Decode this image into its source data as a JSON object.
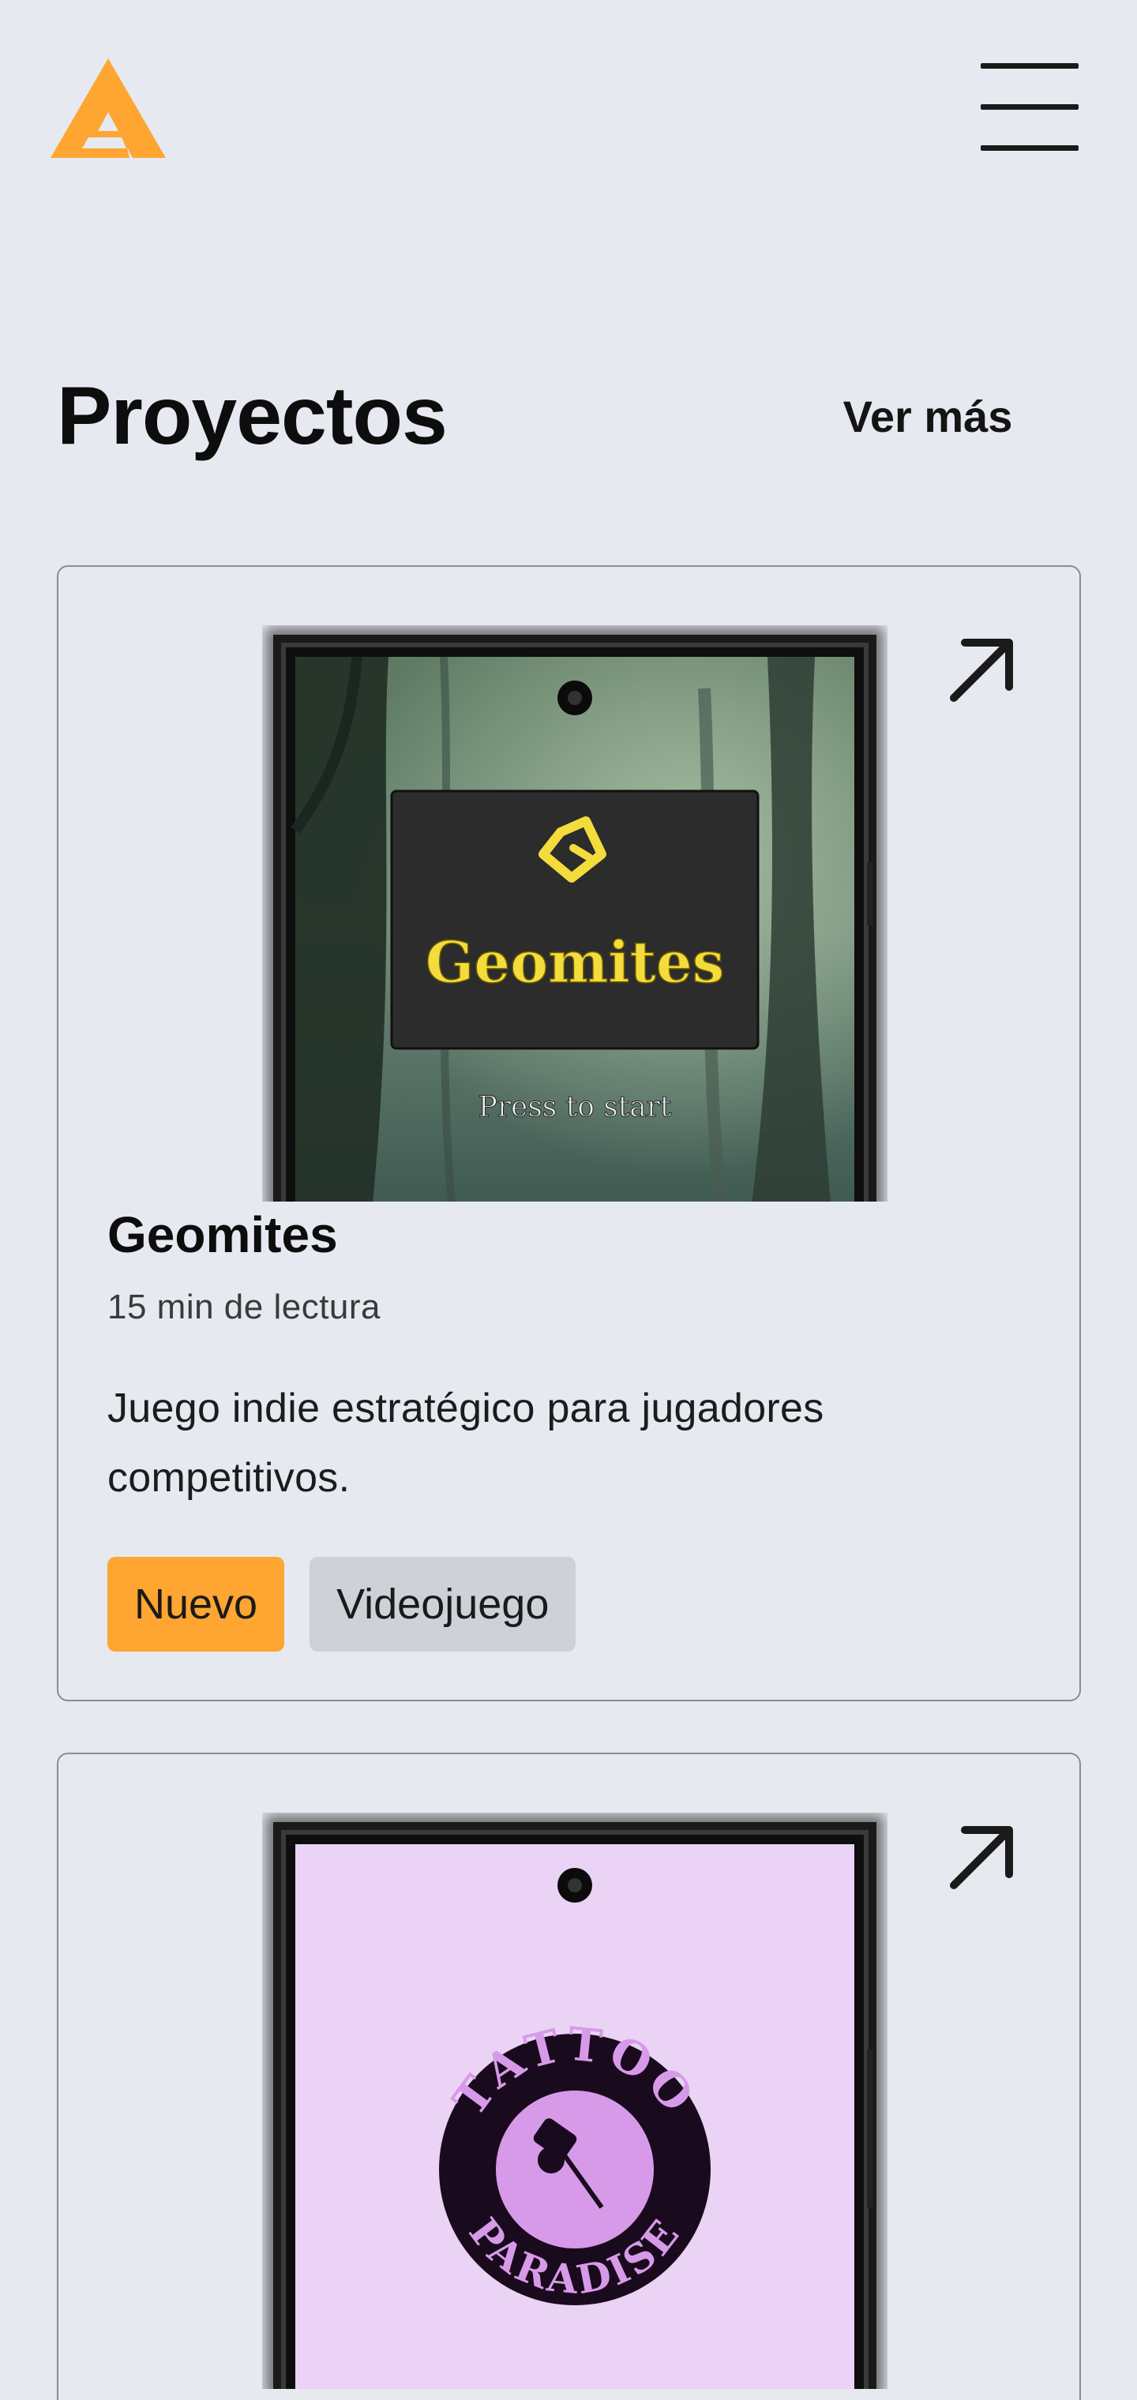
{
  "header": {
    "logo_icon": "brand-a-logo-icon",
    "menu_icon": "hamburger-menu-icon",
    "accent_color": "#ffa531"
  },
  "section": {
    "title": "Proyectos",
    "see_more": "Ver más"
  },
  "projects": [
    {
      "title": "Geomites",
      "read_time": "15 min de lectura",
      "description": "Juego indie estratégico para jugadores competitivos.",
      "tags": [
        "Nuevo",
        "Videojuego"
      ],
      "tag_colors": [
        "#ffa531",
        "#ced1d7"
      ],
      "link_icon": "arrow-up-right-icon",
      "screen": {
        "logo_text": "Geomites",
        "prompt": "Press to start"
      }
    },
    {
      "link_icon": "arrow-up-right-icon",
      "screen": {
        "badge_text_top": "TATTOO",
        "badge_text_bottom": "PARADISE"
      }
    }
  ]
}
